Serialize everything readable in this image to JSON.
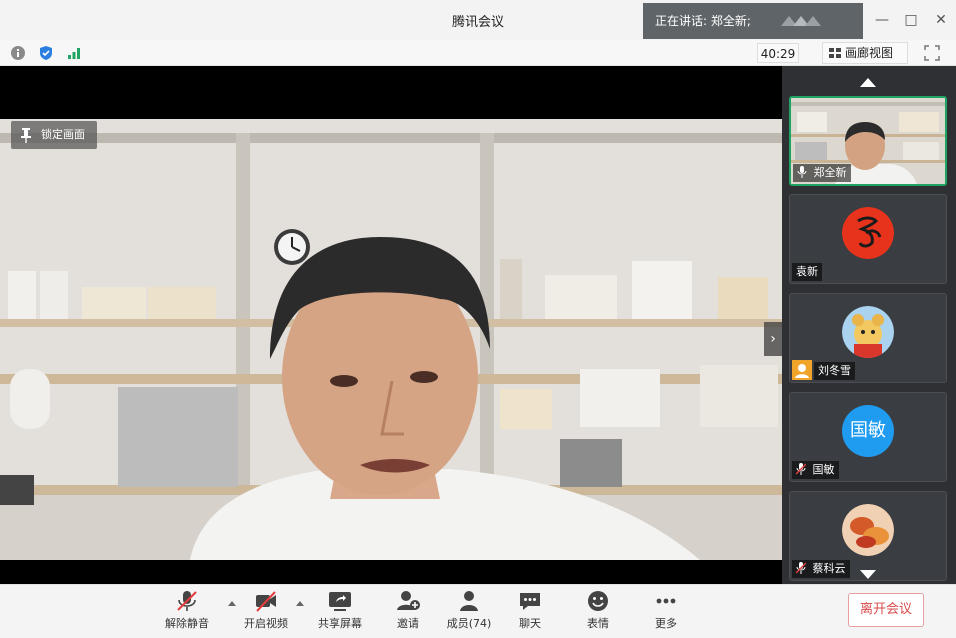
{
  "window": {
    "title": "腾讯会议",
    "speaking": "正在讲话: 郑全新;"
  },
  "infobar": {
    "timer": "40:29",
    "gallery_label": "画廊视图"
  },
  "stage": {
    "lock_label": "锁定画面"
  },
  "participants": [
    {
      "name": "郑全新",
      "kind": "video"
    },
    {
      "name": "袁新",
      "kind": "avatar",
      "avatar_text": "",
      "color": "#e8331c"
    },
    {
      "name": "刘冬雪",
      "kind": "avatar",
      "avatar_text": "",
      "color": "#f4c860"
    },
    {
      "name": "国敏",
      "kind": "avatar",
      "avatar_text": "国敏",
      "color": "#1f9cf0"
    },
    {
      "name": "蔡科云",
      "kind": "avatar",
      "avatar_text": "",
      "color": "#d45a2a"
    }
  ],
  "controls": {
    "mute": "解除静音",
    "video": "开启视频",
    "share": "共享屏幕",
    "invite": "邀请",
    "members": "成员(74)",
    "chat": "聊天",
    "emoji": "表情",
    "more": "更多",
    "leave": "离开会议"
  },
  "colors": {
    "active_border": "#1fa463",
    "leave_text": "#d84a4a"
  }
}
